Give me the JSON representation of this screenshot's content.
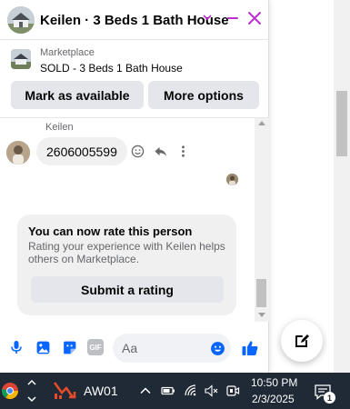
{
  "colors": {
    "accent": "#bf2ed1",
    "accent_blue": "#0866ff",
    "taskbar_bg": "#1f2a36"
  },
  "header": {
    "title": "Keilen · 3 Beds 1 Bath House",
    "avatar_icon": "house-photo-avatar",
    "caret_icon": "chevron-down-icon",
    "minimize_icon": "minimize-icon",
    "close_icon": "close-icon"
  },
  "marketplace": {
    "label": "Marketplace",
    "listing_title": "SOLD - 3 Beds 1 Bath House",
    "mark_available_label": "Mark as available",
    "more_options_label": "More options"
  },
  "thread": {
    "sender_name": "Keilen",
    "message_text": "2606005599",
    "actions": [
      "emoji-icon",
      "reply-icon",
      "more-icon"
    ]
  },
  "rating": {
    "title": "You can now rate this person",
    "description": "Rating your experience with Keilen helps others on Marketplace.",
    "button_label": "Submit a rating"
  },
  "composer": {
    "placeholder": "Aa",
    "gif_label": "GIF",
    "icons": [
      "microphone-icon",
      "photo-icon",
      "sticker-icon",
      "gif-icon",
      "emoji-icon",
      "thumbs-up-icon"
    ]
  },
  "taskbar": {
    "app_label": "AW01",
    "time": "10:50 PM",
    "date": "2/3/2025",
    "notification_count": "1"
  }
}
